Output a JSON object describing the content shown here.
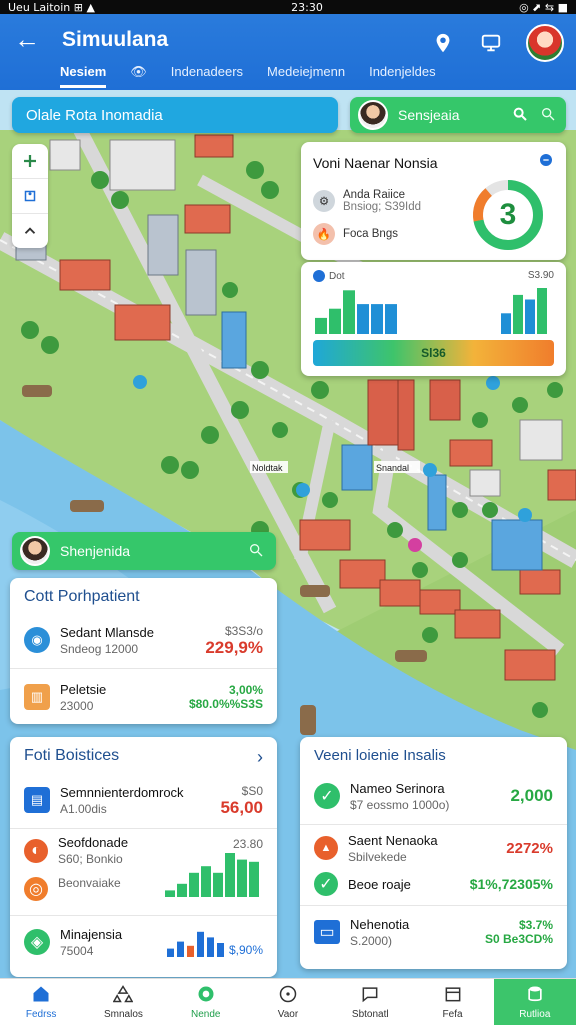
{
  "status_bar": {
    "left": "Ueu  Laitoin  ⊞  ▲",
    "center": "23:30",
    "right": "◎  ⬈  ⇆  ■"
  },
  "app_bar": {
    "title": "Simuulana",
    "tabs": [
      {
        "label": "Nesiem",
        "active": true
      },
      {
        "label": "Indenadeers",
        "active": false
      },
      {
        "label": "Medeiejmenn",
        "active": false
      },
      {
        "label": "Indenjeldes",
        "active": false
      }
    ]
  },
  "search_left": {
    "text": "Olale Rota Inomadia"
  },
  "search_right": {
    "text": "Sensjeaia"
  },
  "overview_card": {
    "title": "Voni Naenar Nonsia",
    "rows": [
      {
        "label": "Anda Raiice",
        "sub": "Bnsiog; S39Idd"
      },
      {
        "label": "Foca Bngs"
      }
    ],
    "ring_value": "3",
    "ring_percent": 72,
    "accent": "#2fbf6b",
    "accent2": "#f07d2c"
  },
  "bar_card": {
    "left_label": "Dot",
    "right_label": "S3.90",
    "bar_text": "Sl36",
    "bars_left": [
      0.35,
      0.55,
      0.95,
      0.65,
      0.65,
      0.65
    ],
    "bars_right": [
      0.45,
      0.85,
      0.75,
      1.0
    ]
  },
  "map_labels": {
    "place_one": "Noldtak",
    "place_two": "Snandal"
  },
  "green_panel": {
    "text": "Shenjenida"
  },
  "cost_card": {
    "title": "Cott Porhpatient",
    "items": [
      {
        "label": "Sedant Mlansde",
        "sub": "Sndeog 12000",
        "top": "$3S3/o",
        "value": "229,9%",
        "value_color": "red"
      },
      {
        "label": "Peletsie",
        "sub": "23000",
        "top": "3,00%",
        "value": "$80.0%%S3S",
        "value_color": "green"
      }
    ]
  },
  "fort_card": {
    "title": "Foti Boistices",
    "chevron": "›",
    "items": [
      {
        "label": "Semnnienterdomrock",
        "sub": "A1.00dis",
        "top": "$S0",
        "value": "56,00",
        "value_color": "red"
      },
      {
        "label": "Seofdonade",
        "sub": "S60; Bonkio",
        "sub2": "Beonvaiake",
        "top": "23.80",
        "bars": [
          0.15,
          0.3,
          0.55,
          0.7,
          0.55,
          1.0,
          0.85,
          0.8
        ]
      },
      {
        "label": "Minajensia",
        "sub": "75004",
        "value": "$,90%",
        "bars": [
          0.3,
          0.55,
          0.4,
          0.9,
          0.7,
          0.5
        ]
      }
    ]
  },
  "event_card": {
    "title": "Veeni loienie Insalis",
    "items": [
      {
        "label": "Nameo Serinora",
        "sub": "$7 eossmo 1000o)",
        "value": "2,000",
        "value_color": "green"
      },
      {
        "label": "Saent Nenaoka",
        "sub": "Sbilvekede",
        "value": "2272%",
        "value_color": "red"
      },
      {
        "label": "Beoe roaje",
        "sub": "",
        "value": "$1%,72305%",
        "value_color": "green"
      },
      {
        "label": "Nehenotia",
        "sub": "S.2000)",
        "top": "$3.7%",
        "value": "S0 Be3CD%",
        "value_color": "green"
      }
    ]
  },
  "bottom_nav": [
    {
      "label": "Fedrss",
      "icon": "home-icon",
      "state": "active"
    },
    {
      "label": "Smnalos",
      "icon": "recycle-icon",
      "state": ""
    },
    {
      "label": "Nende",
      "icon": "map-pin-icon",
      "state": "active"
    },
    {
      "label": "Vaor",
      "icon": "compass-icon",
      "state": ""
    },
    {
      "label": "Sbtonatl",
      "icon": "chat-icon",
      "state": ""
    },
    {
      "label": "Fefa",
      "icon": "calendar-icon",
      "state": ""
    },
    {
      "label": "Rutlioa",
      "icon": "database-icon",
      "state": "cta"
    }
  ]
}
